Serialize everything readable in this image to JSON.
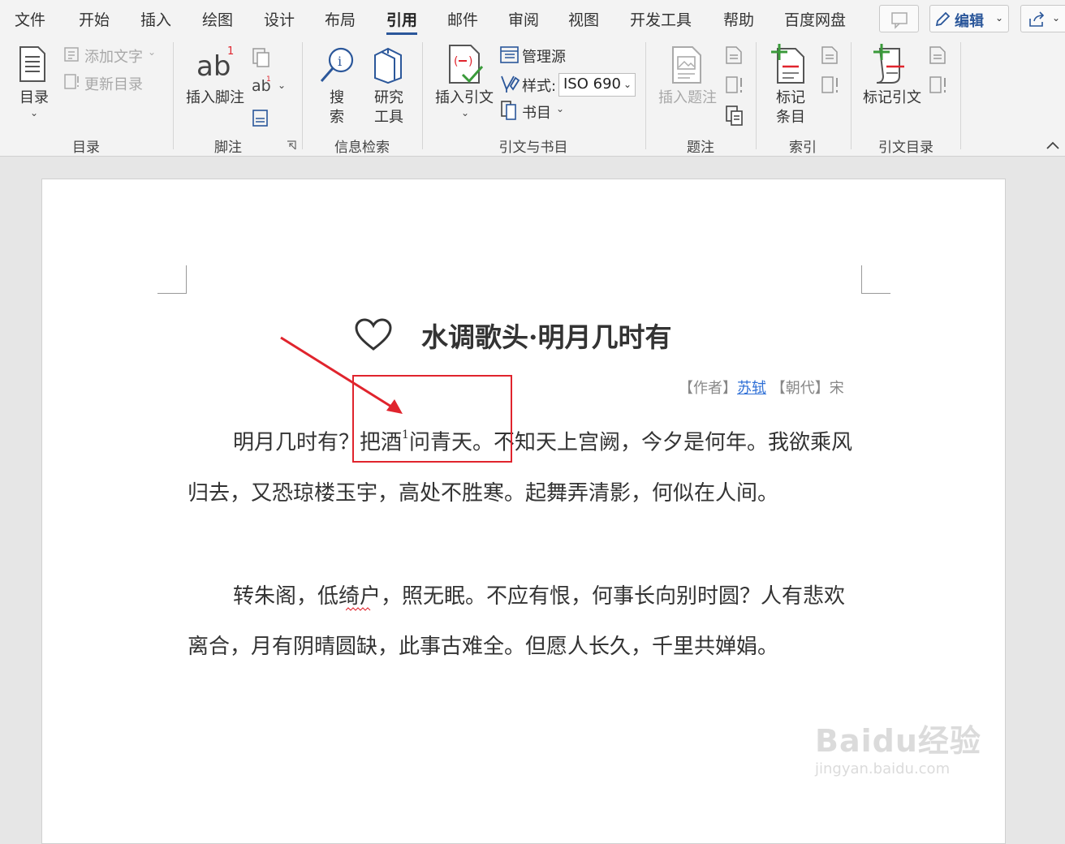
{
  "menu": {
    "tabs": [
      "文件",
      "开始",
      "插入",
      "绘图",
      "设计",
      "布局",
      "引用",
      "邮件",
      "审阅",
      "视图",
      "开发工具",
      "帮助",
      "百度网盘"
    ],
    "active_tab": "引用",
    "edit_label": "编辑"
  },
  "ribbon": {
    "toc": {
      "button": "目录",
      "add_text": "添加文字",
      "update": "更新目录",
      "group": "目录"
    },
    "footnotes": {
      "insert": "插入脚注",
      "group": "脚注"
    },
    "research": {
      "search": "搜索",
      "search_line1": "搜",
      "search_line2": "索",
      "tools_line1": "研究",
      "tools_line2": "工具",
      "group": "信息检索"
    },
    "citations": {
      "insert": "插入引文",
      "manage": "管理源",
      "style_label": "样式:",
      "style_value": "ISO 690",
      "bibliography": "书目",
      "group": "引文与书目"
    },
    "captions": {
      "insert": "插入题注",
      "group": "题注"
    },
    "index": {
      "mark_line1": "标记",
      "mark_line2": "条目",
      "group": "索引"
    },
    "toa": {
      "mark": "标记引文",
      "group": "引文目录"
    }
  },
  "document": {
    "title": "水调歌头·明月几时有",
    "meta_prefix": "【作者】",
    "author": "苏轼",
    "meta_dynasty_label": "【朝代】",
    "dynasty": "宋",
    "para1_a": "明月几时有？把酒",
    "footnote_ref": "1",
    "para1_b": "问青天。不知天上宫阙，今夕是何年。我欲乘风归去，又恐琼楼玉宇，高处不胜寒。起舞弄清影，何似在人间。",
    "para2": "转朱阁，低绮户，照无眠。不应有恨，何事长向别时圆？人有悲欢离合，月有阴晴圆缺，此事古难全。但愿人长久，千里共婵娟。"
  },
  "watermark": {
    "logo": "Baidu经验",
    "url": "jingyan.baidu.com"
  },
  "colors": {
    "accent": "#2b579a",
    "annotation": "#e0242d",
    "link": "#2e6fd6"
  }
}
